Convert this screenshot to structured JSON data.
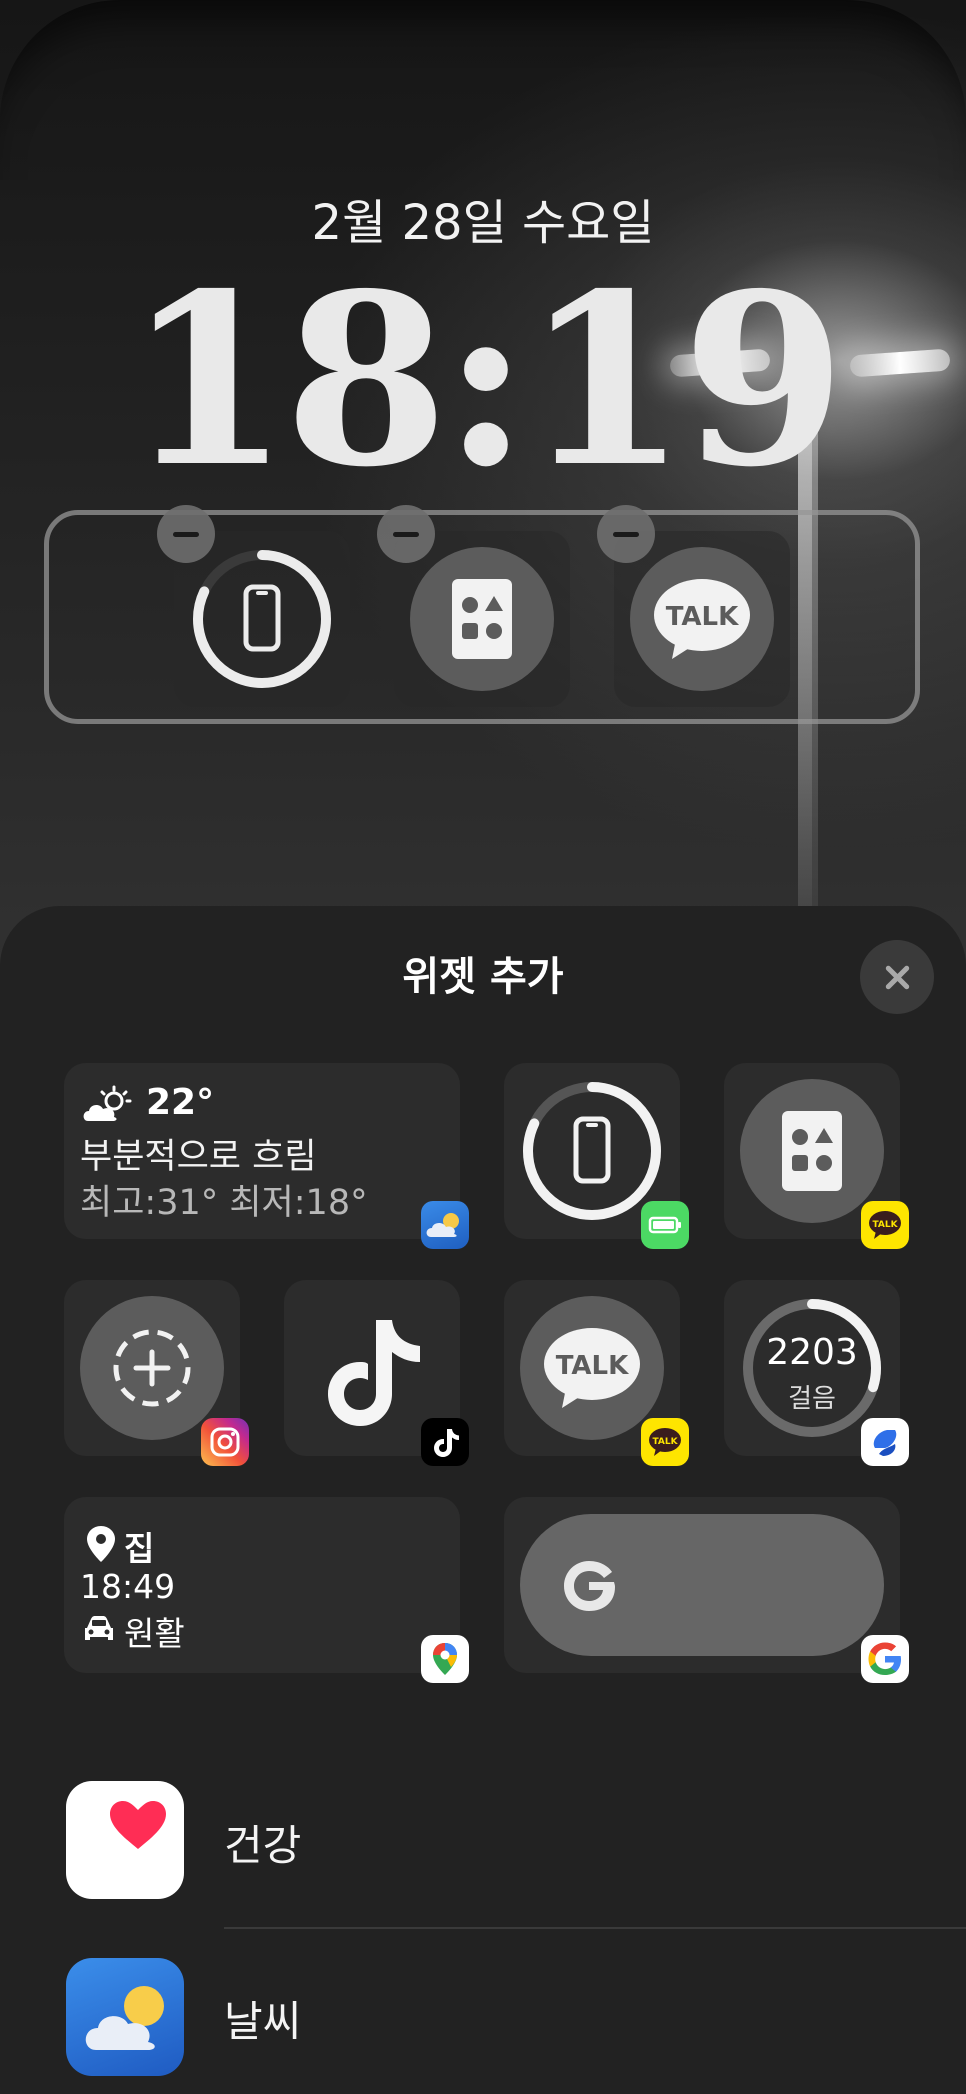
{
  "lock_screen": {
    "date": "2월 28일 수요일",
    "time": "18:19"
  },
  "sheet": {
    "title": "위젯 추가"
  },
  "weather_widget": {
    "temperature": "22°",
    "condition": "부분적으로 흐림",
    "range": "최고:31° 최저:18°"
  },
  "talk_label": "TALK",
  "steps_widget": {
    "value": "2203",
    "label": "걸음"
  },
  "maps_widget": {
    "place": "집",
    "eta": "18:49",
    "traffic": "원활"
  },
  "app_list": [
    {
      "label": "건강",
      "icon": "health-heart-icon"
    },
    {
      "label": "날씨",
      "icon": "weather-app-icon"
    }
  ],
  "colors": {
    "sheet_bg": "#222222",
    "tile_bg": "#2c2c2c",
    "kakao_yellow": "#FEE500",
    "battery_green": "#4CD964",
    "health_red": "#FF2D55",
    "weather_blue": "#2F7FE0"
  }
}
